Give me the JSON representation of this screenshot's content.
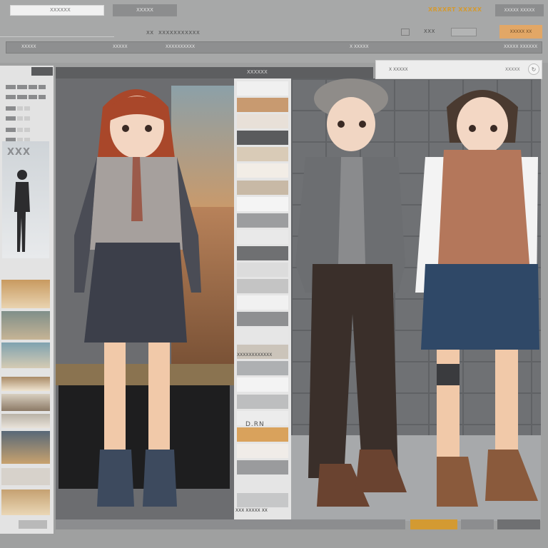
{
  "toolbar": {
    "search_text": "XXXXXX",
    "tab_a": "XXXXX",
    "brand": "XRXXRT XXXXX",
    "tab_b": "XXXXX XXXXX",
    "crumb_arrow": "XX",
    "crumb_path": "XXXXXXXXXXX",
    "dim_label": "XXX",
    "apply_label": "XXXXX XX"
  },
  "subbar": {
    "item1": "XXXXX",
    "item2": "XXXXX",
    "item3": "XXXXXXXXXX",
    "item4": "X XXXXX",
    "item5": "XXXXX XXXXXX"
  },
  "left_panel": {
    "photo_title": "XXX"
  },
  "canvas": {
    "title": "XXXXXX"
  },
  "swatches": {
    "label": "XXXXXXXXXXXX",
    "tag": "D.RN",
    "footer": "XXX XXXXX XX",
    "colors": [
      "#f0f0f0",
      "#c89a70",
      "#e8e0d8",
      "#5a5b5d",
      "#d9cbb7",
      "#f2ede6",
      "#c8b9a6",
      "#f4f4f4",
      "#9c9d9f",
      "#e9e9e9",
      "#6f7072",
      "#dcdcdc",
      "#c4c4c4",
      "#f1f1f1",
      "#8e8f91",
      "#e6e6e6",
      "#cbc4ba",
      "#aeb0b2",
      "#f3f3f3",
      "#bdbebf",
      "#ececec",
      "#d9a25c",
      "#f0ece8",
      "#9a9b9d",
      "#e5e5e5",
      "#c6c7c8"
    ]
  },
  "overlay": {
    "title": "X XXXXX",
    "close": "XXXXX"
  },
  "characters": [
    {
      "name_hint": "red-haired girl"
    },
    {
      "name_hint": "boy in cap"
    },
    {
      "name_hint": "boy in vest"
    }
  ]
}
